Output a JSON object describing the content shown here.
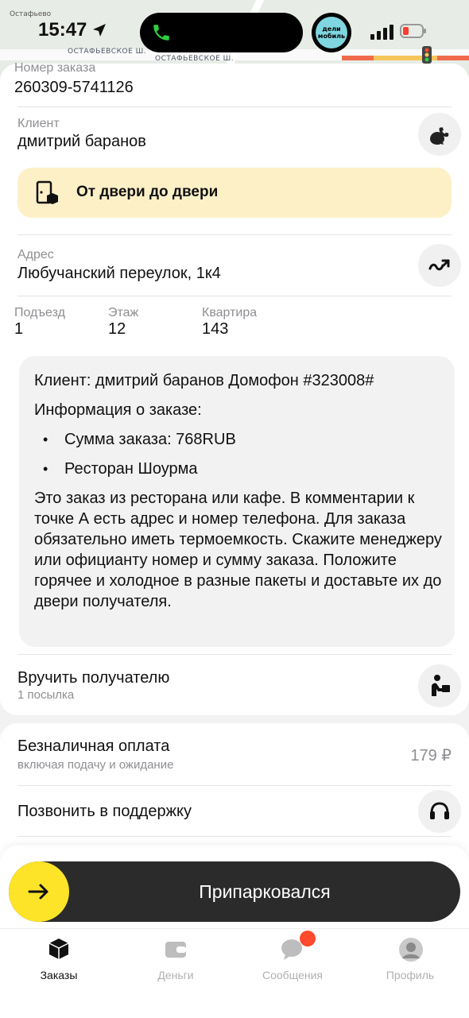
{
  "status_bar": {
    "time": "15:47",
    "place_name": "Остафьево",
    "road_label_left": "ОСТАФЬЕВСКОЕ Ш.",
    "road_label_right": "ОСТАФЬЕВСКОЕ Ш.",
    "app_badge": "дели мобиль"
  },
  "order": {
    "number_label": "Номер заказа",
    "number_value": "260309-5741126"
  },
  "client": {
    "label": "Клиент",
    "name": "дмитрий баранов"
  },
  "delivery_type": {
    "label": "От двери до двери"
  },
  "address": {
    "label": "Адрес",
    "value": "Любучанский переулок, 1к4"
  },
  "details": [
    {
      "label": "Подъезд",
      "value": "1"
    },
    {
      "label": "Этаж",
      "value": "12"
    },
    {
      "label": "Квартира",
      "value": "143"
    }
  ],
  "comment": {
    "line1": "Клиент: дмитрий баранов Домофон #323008#",
    "line2": "Информация о заказе:",
    "bullets": [
      "Сумма заказа: 768RUB",
      "Ресторан Шоурма"
    ],
    "paragraph": "Это заказ из ресторана или кафе. В комментарии к точке А есть адрес и номер телефона. Для заказа обязательно иметь термоемкость. Скажите менеджеру или официанту номер и сумму заказа. Положите горячее и холодное в разные пакеты и доставьте их до двери получателя."
  },
  "handover": {
    "title": "Вручить получателю",
    "subtitle": "1 посылка"
  },
  "payment": {
    "title": "Безналичная оплата",
    "subtitle": "включая подачу и ожидание",
    "amount": "179 ₽"
  },
  "support": {
    "title": "Позвонить в поддержку"
  },
  "primary_action": {
    "label": "Припарковался"
  },
  "tabs": [
    {
      "label": "Заказы",
      "icon": "box-icon",
      "active": true
    },
    {
      "label": "Деньги",
      "icon": "wallet-icon",
      "active": false
    },
    {
      "label": "Сообщения",
      "icon": "chat-icon",
      "active": false
    },
    {
      "label": "Профиль",
      "icon": "avatar-icon",
      "active": false
    }
  ],
  "colors": {
    "accent_yellow": "#fde428",
    "banner_bg": "#fdf0c7",
    "notification_red": "#ff4a2d"
  }
}
